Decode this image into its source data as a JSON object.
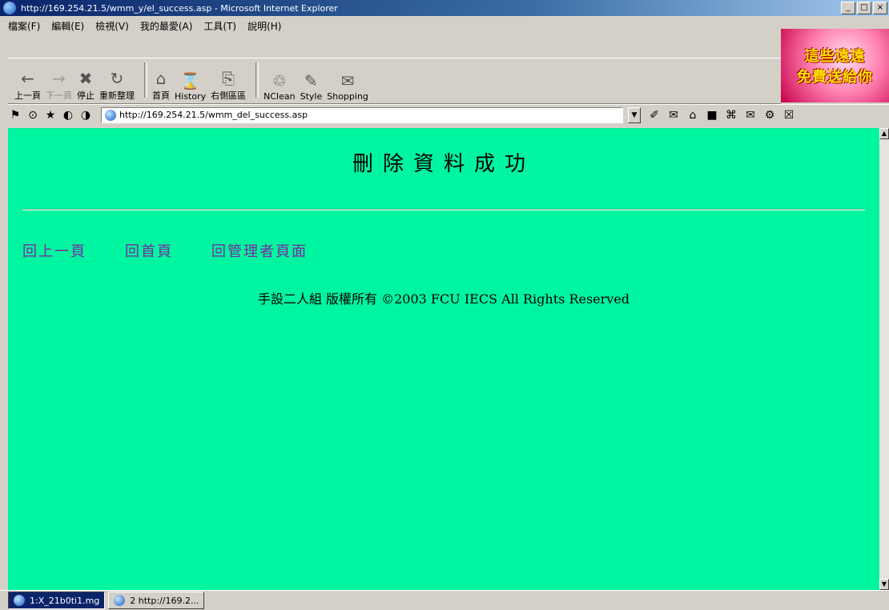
{
  "window": {
    "title": "http://169.254.21.5/wmm_y/el_success.asp - Microsoft Internet Explorer",
    "buttons": {
      "minimize": "_",
      "maximize": "□",
      "close": "×"
    }
  },
  "menubar": {
    "items": [
      "檔案(F)",
      "編輯(E)",
      "檢視(V)",
      "我的最愛(A)",
      "工具(T)",
      "說明(H)"
    ]
  },
  "toolbar": {
    "buttons": [
      {
        "label": "上一頁",
        "icon": "←"
      },
      {
        "label": "下一頁",
        "icon": "→"
      },
      {
        "label": "停止",
        "icon": "✖"
      },
      {
        "label": "重新整理",
        "icon": "↻"
      },
      {
        "label": "首頁",
        "icon": "⌂"
      },
      {
        "label": "History",
        "icon": "⌛"
      },
      {
        "label": "右側區區",
        "icon": "⎘"
      },
      {
        "label": "NClean",
        "icon": "♲"
      },
      {
        "label": "Style",
        "icon": "✎"
      },
      {
        "label": "Shopping",
        "icon": "✉"
      }
    ]
  },
  "ad": {
    "line1": "這些遠遠",
    "line2": "免費送給你"
  },
  "address": {
    "url": "http://169.254.21.5/wmm_del_success.asp",
    "left_icons": [
      "⚑",
      "⊙",
      "★",
      "◐",
      "◑"
    ],
    "right_icons": [
      "✐",
      "✉",
      "⌂",
      "■",
      "⌘",
      "✉",
      "⚙",
      "☒"
    ]
  },
  "page": {
    "title": "刪除資料成功",
    "links": [
      "回上一頁",
      "回首頁",
      "回管理者頁面"
    ],
    "footer": "手設二人組  版權所有 ©2003 FCU IECS All Rights Reserved"
  },
  "taskbar": {
    "items": [
      {
        "label": "1:X_21b0ti1.mg",
        "active": true
      },
      {
        "label": "2 http://169.2...",
        "active": false
      }
    ]
  }
}
